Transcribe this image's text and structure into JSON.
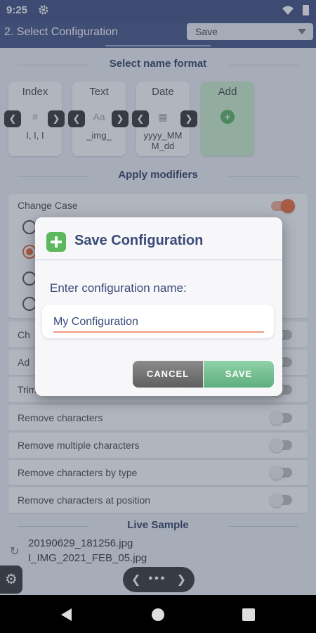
{
  "status_bar": {
    "time": "9:25"
  },
  "app_bar": {
    "title": "2. Select Configuration",
    "dropdown_value": "Save"
  },
  "name_format": {
    "heading": "Select name format",
    "cards": [
      {
        "title": "Index",
        "placeholder": "#",
        "value": "I, I, I"
      },
      {
        "title": "Text",
        "placeholder": "Aa",
        "value": "_img_"
      },
      {
        "title": "Date",
        "placeholder": "calendar",
        "value": "yyyy_MMM_dd"
      },
      {
        "title": "Add",
        "placeholder": "+",
        "value": ""
      }
    ]
  },
  "modifiers": {
    "heading": "Apply modifiers",
    "change_case": "Change Case",
    "rows": [
      "Ch",
      "Ad",
      "Trim",
      "Remove characters",
      "Remove multiple characters",
      "Remove characters by type",
      "Remove characters at position"
    ]
  },
  "live_sample": {
    "heading": "Live Sample",
    "lines": [
      "20190629_181256.jpg",
      "I_IMG_2021_FEB_05.jpg"
    ]
  },
  "dialog": {
    "title": "Save Configuration",
    "prompt": "Enter configuration name:",
    "input_value": "My Configuration",
    "cancel_label": "CANCEL",
    "save_label": "SAVE"
  }
}
